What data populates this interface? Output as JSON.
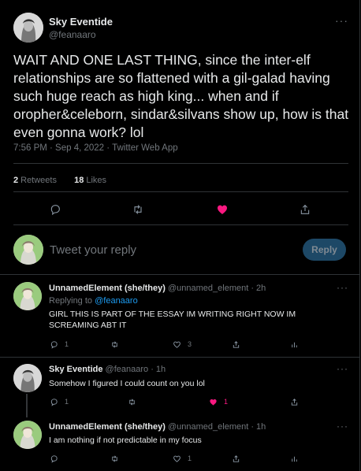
{
  "main_tweet": {
    "author_name": "Sky Eventide",
    "author_handle": "@feanaaro",
    "text": "WAIT AND ONE LAST THING, since the inter-elf relationships are so flattened with a gil-galad having such huge reach as high king... when and if oropher&celeborn, sindar&silvans show up, how is that even gonna work? lol",
    "meta": "7:56 PM · Sep 4, 2022 · Twitter Web App",
    "more_glyph": "···",
    "retweets_count": "2",
    "retweets_label": "Retweets",
    "likes_count": "18",
    "likes_label": "Likes",
    "actions": [
      "reply-icon",
      "retweet-icon",
      "liked-heart-icon",
      "share-icon"
    ]
  },
  "composer": {
    "placeholder": "Tweet your reply",
    "button_label": "Reply"
  },
  "replies": [
    {
      "author_name": "UnnamedElement (she/they)",
      "author_handle": "@unnamed_element · 2h",
      "replying_label": "Replying to",
      "replying_to": "@feanaaro",
      "text": "GIRL THIS IS PART OF THE ESSAY IM WRITING RIGHT NOW IM SCREAMING ABT IT",
      "replies": "1",
      "retweets": "",
      "likes": "3",
      "liked": false,
      "more_glyph": "···"
    },
    {
      "author_name": "Sky Eventide",
      "author_handle": "@feanaaro · 1h",
      "text": "Somehow I figured I could count on you lol",
      "replies": "1",
      "retweets": "",
      "likes": "1",
      "liked": true,
      "more_glyph": "···"
    },
    {
      "author_name": "UnnamedElement (she/they)",
      "author_handle": "@unnamed_element · 1h",
      "text": "I am nothing if not predictable in my focus",
      "replies": "",
      "retweets": "",
      "likes": "1",
      "liked": false,
      "more_glyph": "···"
    }
  ],
  "colors": {
    "background": "#000000",
    "text": "#e7e9ea",
    "muted": "#71767b",
    "link": "#1d9bf0",
    "like": "#f91880",
    "reply_button_bg": "#1d4866"
  }
}
